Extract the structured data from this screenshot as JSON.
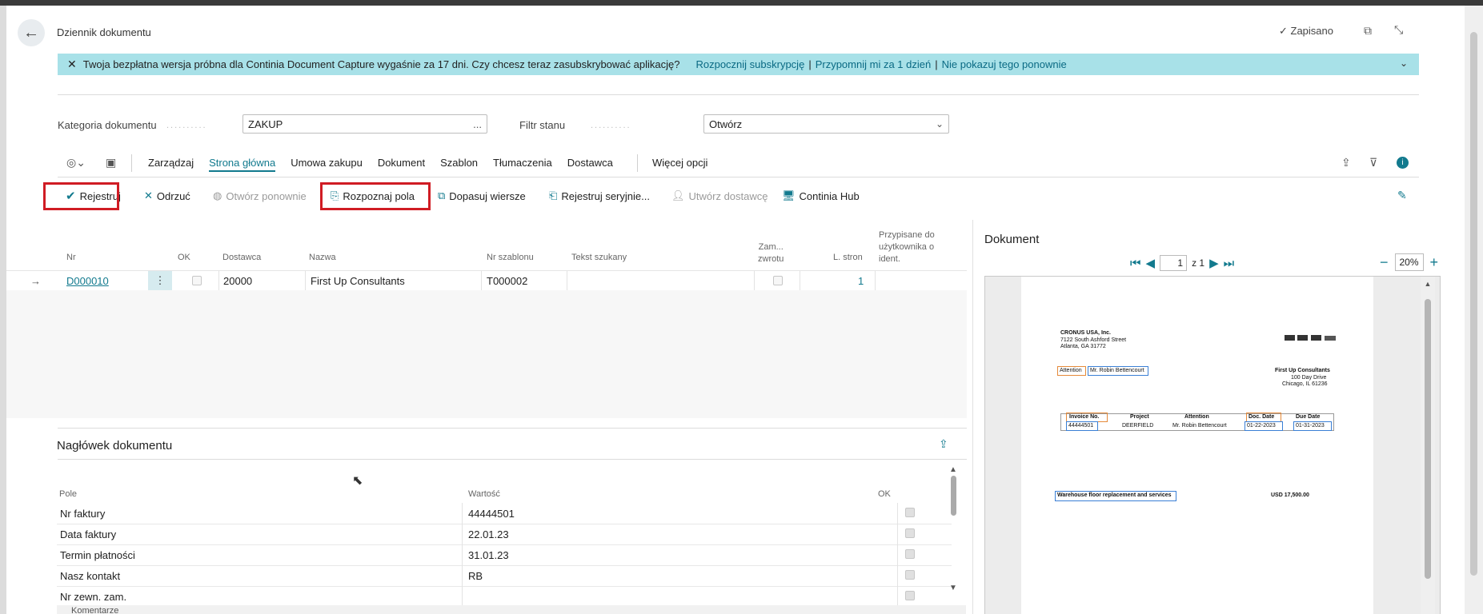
{
  "header": {
    "title": "Dziennik dokumentu",
    "saved_label": "Zapisano"
  },
  "banner": {
    "message": "Twoja bezpłatna wersja próbna dla Continia Document Capture wygaśnie za 17 dni. Czy chcesz teraz zasubskrybować aplikację?",
    "link_subscribe": "Rozpocznij subskrypcję",
    "link_remind": "Przypomnij mi za 1 dzień",
    "link_dismiss": "Nie pokazuj tego ponownie",
    "sep": "|"
  },
  "filters": {
    "category_label": "Kategoria dokumentu",
    "category_value": "ZAKUP",
    "category_more": "...",
    "status_label": "Filtr stanu",
    "status_value": "Otwórz"
  },
  "menu": {
    "items": [
      "Zarządzaj",
      "Strona główna",
      "Umowa zakupu",
      "Dokument",
      "Szablon",
      "Tłumaczenia",
      "Dostawca"
    ],
    "more": "Więcej opcji"
  },
  "actions": {
    "register": "Rejestruj",
    "reject": "Odrzuć",
    "reopen": "Otwórz ponownie",
    "recognize": "Rozpoznaj pola",
    "match": "Dopasuj wiersze",
    "batch": "Rejestruj seryjnie...",
    "create_vendor": "Utwórz dostawcę",
    "hub": "Continia Hub"
  },
  "grid": {
    "columns": {
      "nr": "Nr",
      "ok": "OK",
      "vendor": "Dostawca",
      "name": "Nazwa",
      "template": "Nr szablonu",
      "search": "Tekst szukany",
      "return_l1": "Zam...",
      "return_l2": "zwrotu",
      "pages": "L. stron",
      "assigned_l1": "Przypisane do",
      "assigned_l2": "użytkownika o",
      "assigned_l3": "ident."
    },
    "row": {
      "nr": "D000010",
      "vendor": "20000",
      "name": "First Up Consultants",
      "template": "T000002",
      "pages": "1"
    }
  },
  "doc_header": {
    "title": "Nagłówek dokumentu",
    "col_field": "Pole",
    "col_value": "Wartość",
    "col_ok": "OK",
    "rows": [
      {
        "field": "Nr faktury",
        "value": "44444501"
      },
      {
        "field": "Data faktury",
        "value": "22.01.23"
      },
      {
        "field": "Termin płatności",
        "value": "31.01.23"
      },
      {
        "field": "Nasz kontakt",
        "value": "RB"
      },
      {
        "field": "Nr zewn. zam.",
        "value": ""
      }
    ],
    "comments": "Komentarze"
  },
  "document_panel": {
    "title": "Dokument",
    "page_current": "1",
    "page_of": "z 1",
    "zoom": "20%"
  },
  "invoice": {
    "company": "CRONUS USA, Inc.",
    "addr1": "7122 South Ashford Street",
    "addr2": "Atlanta, GA 31772",
    "attention_label": "Attention",
    "attention_value": "Mr. Robin Bettencourt",
    "vendor": "First Up Consultants",
    "vendor_addr1": "100 Day Drive",
    "vendor_addr2": "Chicago, IL 61236",
    "t_invoice": "Invoice No.",
    "t_project": "Project",
    "t_attention": "Attention",
    "t_doc_date": "Doc. Date",
    "t_due_date": "Due Date",
    "v_invoice": "44444501",
    "v_project": "DEERFIELD",
    "v_attention": "Mr. Robin Bettencourt",
    "v_doc_date": "01-22-2023",
    "v_due_date": "01-31-2023",
    "line_desc": "Warehouse floor replacement and services",
    "amount": "USD 17,500.00"
  },
  "colors": {
    "accent": "#127a8e",
    "banner": "#a8e1e8",
    "highlight_red": "#d01c24"
  }
}
